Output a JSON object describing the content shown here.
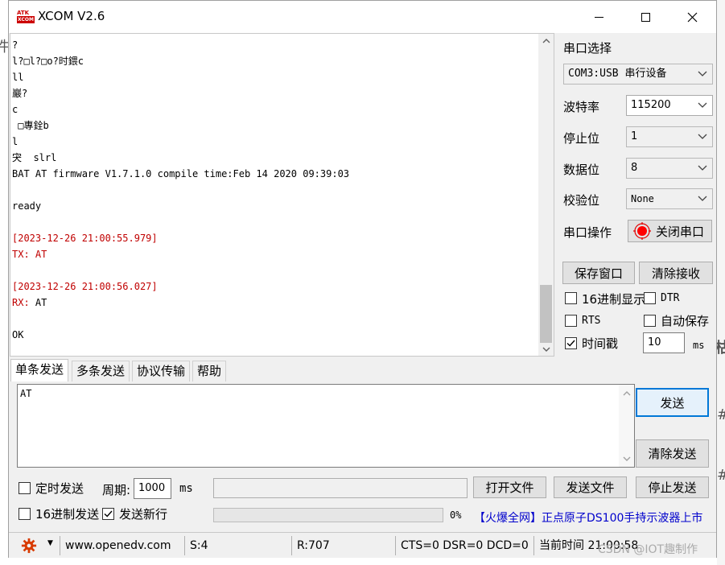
{
  "window": {
    "title": "XCOM V2.6",
    "icon_top": "ATK",
    "icon_bottom": "XCOM",
    "min_icon": "minimize-icon",
    "max_icon": "maximize-icon",
    "close_icon": "close-icon"
  },
  "background": {
    "left_glyph": "件",
    "right_glyph_1": "枯",
    "right_glyph_2": "#",
    "right_glyph_3": "#"
  },
  "receive": {
    "lines": [
      {
        "text": "?",
        "color": "black"
      },
      {
        "text": "l?□l?□o?时鍡c",
        "color": "black"
      },
      {
        "text": "ll",
        "color": "black"
      },
      {
        "text": "巖?",
        "color": "black"
      },
      {
        "text": "c",
        "color": "black"
      },
      {
        "text": " □專銓b",
        "color": "black"
      },
      {
        "text": "l",
        "color": "black"
      },
      {
        "text": "宊  slrl",
        "color": "black"
      },
      {
        "text": "BAT AT firmware V1.7.1.0 compile time:Feb 14 2020 09:39:03",
        "color": "black"
      },
      {
        "text": "",
        "color": "black"
      },
      {
        "text": "ready",
        "color": "black"
      },
      {
        "text": "",
        "color": "black"
      },
      {
        "text": "[2023-12-26 21:00:55.979]",
        "color": "red"
      },
      {
        "text": "TX: AT",
        "color": "red"
      },
      {
        "text": "",
        "color": "black"
      },
      {
        "text": "[2023-12-26 21:00:56.027]",
        "color": "red"
      },
      {
        "text": "RX: AT",
        "color": "mixed"
      },
      {
        "text": "",
        "color": "black"
      },
      {
        "text": "OK",
        "color": "black"
      }
    ],
    "rx_prefix": "RX:",
    "rx_value": " AT"
  },
  "panel": {
    "port_select_label": "串口选择",
    "port_value": "COM3:USB 串行设备",
    "baud_label": "波特率",
    "baud_value": "115200",
    "stopbit_label": "停止位",
    "stopbit_value": "1",
    "databit_label": "数据位",
    "databit_value": "8",
    "parity_label": "校验位",
    "parity_value": "None",
    "port_op_label": "串口操作",
    "close_port_label": "关闭串口",
    "save_window_label": "保存窗口",
    "clear_recv_label": "清除接收",
    "hex_display_label": "16进制显示",
    "dtr_label": "DTR",
    "rts_label": "RTS",
    "auto_save_label": "自动保存",
    "timestamp_label": "时间戳",
    "timestamp_value": "10",
    "ms_label": "ms",
    "timestamp_checked": true
  },
  "tabs": [
    "单条发送",
    "多条发送",
    "协议传输",
    "帮助"
  ],
  "send": {
    "text": "AT",
    "send_label": "发送",
    "clear_send_label": "清除发送",
    "timed_send_label": "定时发送",
    "period_label": "周期:",
    "period_value": "1000",
    "period_unit": "ms",
    "open_file_label": "打开文件",
    "send_file_label": "发送文件",
    "stop_send_label": "停止发送",
    "hex_send_label": "16进制发送",
    "newline_label": "发送新行",
    "newline_checked": true,
    "progress_text": "0%",
    "progress_value": 0,
    "ad_text": "【火爆全网】正点原子DS100手持示波器上市"
  },
  "status": {
    "url": "www.openedv.com",
    "sent": "S:4",
    "received": "R:707",
    "lines": "CTS=0 DSR=0 DCD=0",
    "time": "当前时间 21:00:58"
  },
  "watermark": "CSDN @IOT趣制作",
  "colors": {
    "red_text": "#c00000",
    "accent": "#0078d7",
    "link": "#0000cc"
  }
}
